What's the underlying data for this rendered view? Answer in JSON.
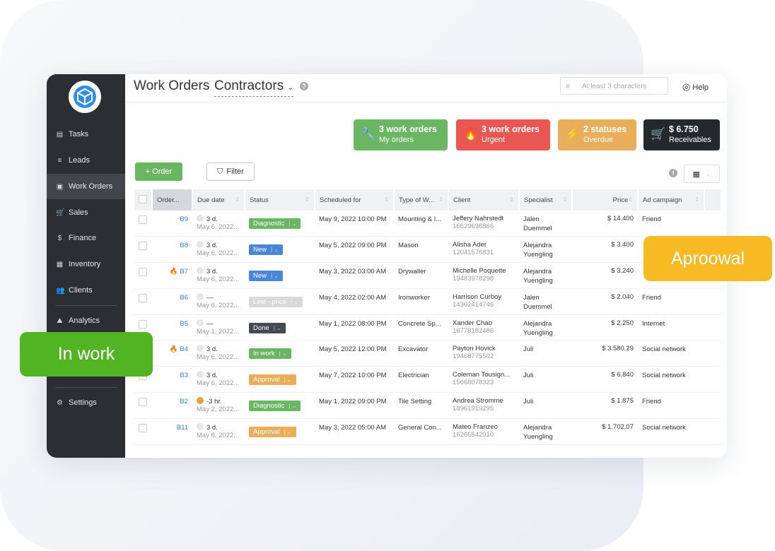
{
  "colors": {
    "sidebar": "#2b2f33",
    "green": "#6ab662",
    "red": "#e85752",
    "orange": "#e9ae5a",
    "dark": "#25292d",
    "blue": "#4a86d6",
    "link": "#3d7cc9",
    "in_work_overlay": "#52b423",
    "approval_overlay": "#f7b924"
  },
  "sidebar": {
    "items": [
      {
        "label": "Tasks",
        "icon": "clipboard-icon"
      },
      {
        "label": "Leads",
        "icon": "filter-icon"
      },
      {
        "label": "Work Orders",
        "icon": "document-icon",
        "active": true
      },
      {
        "label": "Sales",
        "icon": "cart-icon"
      },
      {
        "label": "Finance",
        "icon": "dollar-icon"
      },
      {
        "label": "Inventory",
        "icon": "boxes-icon"
      },
      {
        "label": "Clients",
        "icon": "users-icon"
      },
      {
        "label": "Analytics",
        "icon": "chart-icon"
      },
      {
        "label": "Settings",
        "icon": "gear-icon"
      }
    ]
  },
  "header": {
    "title": "Work Orders",
    "subtitle": "Contractors",
    "search_placeholder": "At least 3 characters",
    "help": "Help"
  },
  "kpis": [
    {
      "value": "3 work orders",
      "label": "My orders",
      "icon": "wrench-icon",
      "color": "#6ab662"
    },
    {
      "value": "3 work orders",
      "label": "Urgent",
      "icon": "fire-icon",
      "color": "#e85752"
    },
    {
      "value": "2 statuses",
      "label": "Overdue",
      "icon": "lightning-icon",
      "color": "#e9ae5a"
    },
    {
      "value": "$ 6.750",
      "label": "Receivables",
      "icon": "cart-icon",
      "color": "#25292d"
    }
  ],
  "toolbar": {
    "order": "+ Order",
    "filter": "Filter"
  },
  "table": {
    "columns": [
      "Order...",
      "Due date",
      "Status",
      "Scheduled for",
      "Type of W...",
      "Client",
      "Specialist",
      "Price",
      "Ad campaign"
    ],
    "rows": [
      {
        "urgent": false,
        "order": "B9",
        "due": "3 d.",
        "due_date": "May 6, 2022...",
        "status": "Diagnostic",
        "status_color": "#6ab662",
        "scheduled": "May 9, 2022 10:00 PM",
        "type": "Mounting & I...",
        "client": "Jeffery Nahrstedt",
        "phone": "16629698866",
        "specialist": [
          "Jalen",
          "Duemmel"
        ],
        "price": "$ 14.400",
        "ad": "Friend"
      },
      {
        "urgent": false,
        "order": "B8",
        "due": "3 d.",
        "due_date": "May 6, 2022...",
        "status": "New",
        "status_color": "#4a86d6",
        "scheduled": "May 5, 2022 09:00 PM",
        "type": "Mason",
        "client": "Alisha Ader",
        "phone": "12041576831",
        "specialist": [
          "Alejandra",
          "Yuengling"
        ],
        "price": "$ 3.400",
        "ad": ""
      },
      {
        "urgent": true,
        "order": "B7",
        "due": "3 d.",
        "due_date": "May 6, 2022...",
        "status": "New",
        "status_color": "#4a86d6",
        "scheduled": "May 3, 2022 03:00 AM",
        "type": "Drywaller",
        "client": "Michelle Poquette",
        "phone": "19483978298",
        "specialist": [
          "Alejandra",
          "Yuengling"
        ],
        "price": "$ 3.240",
        "ad": ""
      },
      {
        "urgent": false,
        "order": "B6",
        "due": "—",
        "due_date": "May 6, 2022...",
        "status": "Lost - price",
        "status_color": "#d8d9db",
        "scheduled": "May 4, 2022 02:00 AM",
        "type": "Ironworker",
        "client": "Harrison Curboy",
        "phone": "14302414746",
        "specialist": [
          "Jalen",
          "Duemmel"
        ],
        "price": "$ 2.040",
        "ad": "Friend"
      },
      {
        "urgent": false,
        "order": "B5",
        "due": "—",
        "due_date": "May 1, 2022...",
        "status": "Done",
        "status_color": "#444a50",
        "scheduled": "May 1, 2022 08:00 PM",
        "type": "Concrete Sp...",
        "client": "Xander Chao",
        "phone": "16778182486",
        "specialist": [
          "Alejandra",
          "Yuengling"
        ],
        "price": "$ 2.250",
        "ad": "Internet"
      },
      {
        "urgent": true,
        "order": "B4",
        "due": "3 d.",
        "due_date": "May 6, 2022...",
        "status": "In work",
        "status_color": "#6ab662",
        "scheduled": "May 5, 2022 12:00 PM",
        "type": "Excavator",
        "client": "Payton Hovick",
        "phone": "19468775502",
        "specialist": [
          "Juli"
        ],
        "price": "$ 3.580.29",
        "ad": "Social network"
      },
      {
        "urgent": false,
        "order": "B3",
        "due": "3 d.",
        "due_date": "May 6, 2022...",
        "status": "Approval",
        "status_color": "#e9ae5a",
        "scheduled": "May 7, 2022 10:00 PM",
        "type": "Electrician",
        "client": "Coleman Tousign...",
        "phone": "15668078323",
        "specialist": [
          "Juli"
        ],
        "price": "$ 6.840",
        "ad": "Social network"
      },
      {
        "urgent": false,
        "overdue": true,
        "order": "B2",
        "due": "-3 hr.",
        "due_date": "May 2, 2022...",
        "status": "Diagnostic",
        "status_color": "#6ab662",
        "scheduled": "May 1, 2022 09:00 PM",
        "type": "Tile Setting",
        "client": "Andrea Stromme",
        "phone": "18961919295",
        "specialist": [
          "Juli"
        ],
        "price": "$ 1.875",
        "ad": "Friend"
      },
      {
        "urgent": false,
        "order": "B11",
        "due": "3 d.",
        "due_date": "May 6, 2022...",
        "status": "Approval",
        "status_color": "#e9ae5a",
        "scheduled": "May 3, 2022 05:00 AM",
        "type": "General Con...",
        "client": "Mateo Franzeo",
        "phone": "16266542010",
        "specialist": [
          "Alejandra",
          "Yuengling"
        ],
        "price": "$ 1.702.07",
        "ad": "Social network"
      }
    ]
  },
  "overlays": {
    "in_work": "In work",
    "approval": "Aproowal"
  }
}
